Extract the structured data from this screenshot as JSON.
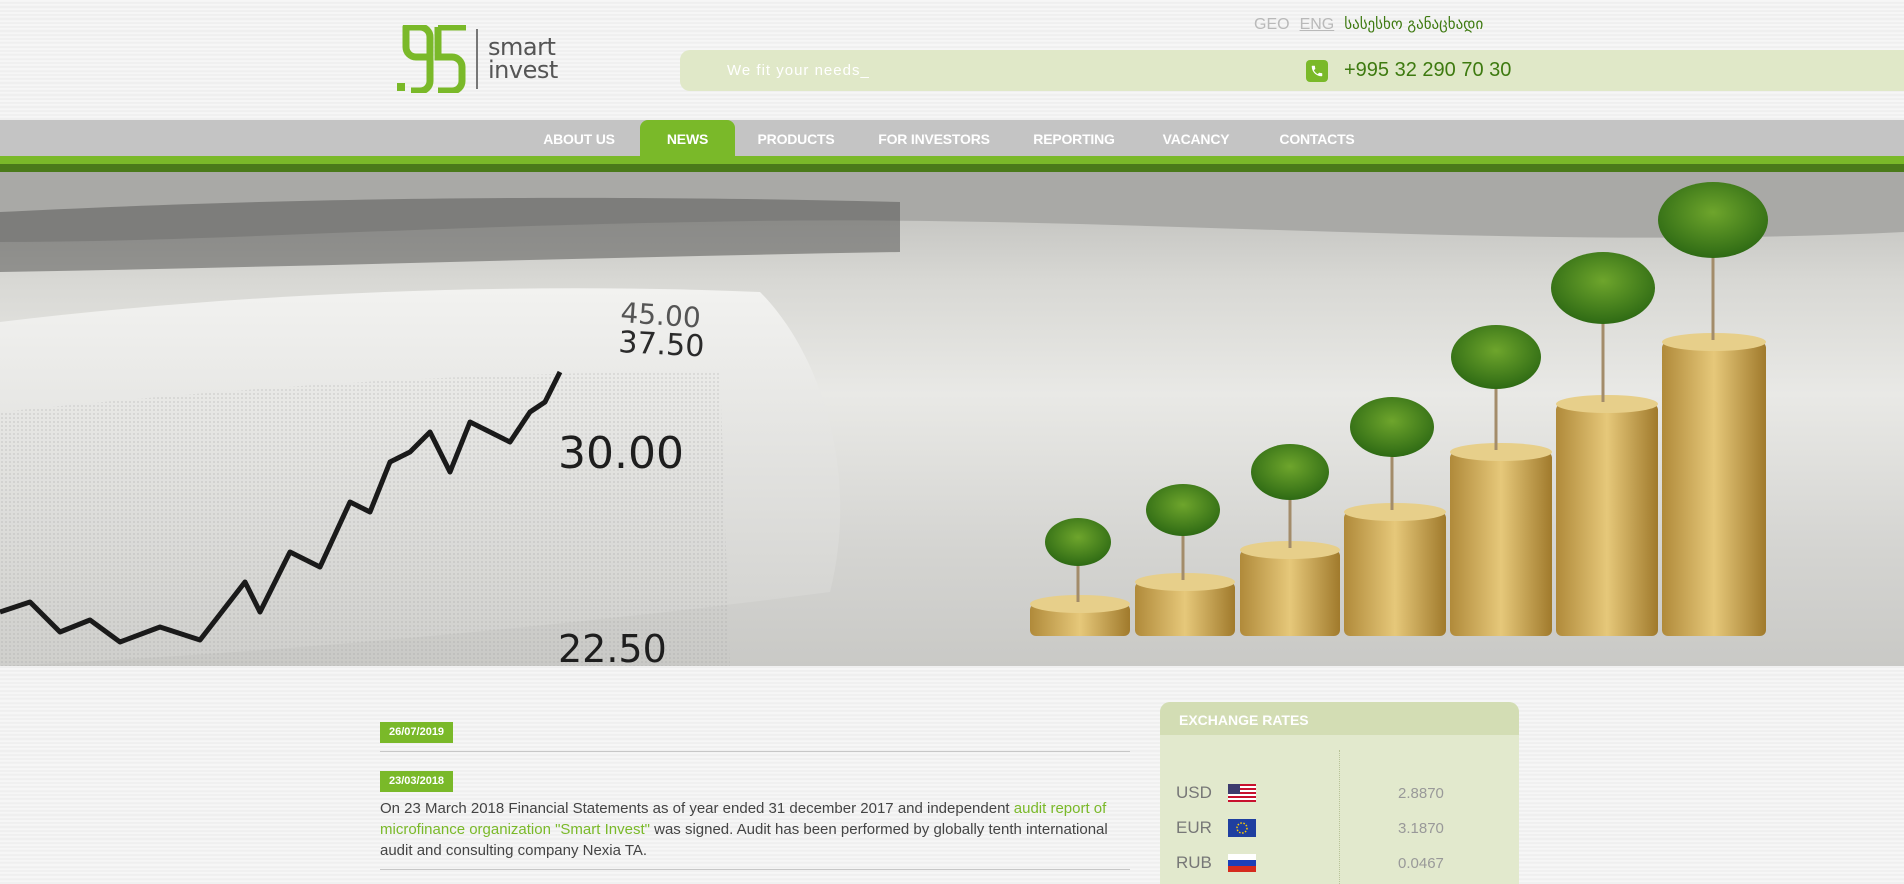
{
  "brand": {
    "logo_line1": "smart",
    "logo_line2": "invest"
  },
  "lang": {
    "geo": "GEO",
    "eng": "ENG",
    "apply": "სასესხო განაცხადი"
  },
  "header": {
    "tagline": "We fit your needs_",
    "phone": "+995 32 290 70 30"
  },
  "nav": {
    "items": [
      {
        "label": "ABOUT US",
        "active": false
      },
      {
        "label": "NEWS",
        "active": true
      },
      {
        "label": "PRODUCTS",
        "active": false
      },
      {
        "label": "FOR INVESTORS",
        "active": false
      },
      {
        "label": "REPORTING",
        "active": false
      },
      {
        "label": "VACANCY",
        "active": false
      },
      {
        "label": "CONTACTS",
        "active": false
      }
    ]
  },
  "hero": {
    "ticks": [
      "45.00",
      "37.50",
      "30.00",
      "22.50"
    ]
  },
  "news": {
    "items": [
      {
        "date": "26/07/2019"
      },
      {
        "date": "23/03/2018",
        "text_before": "On 23 March 2018 Financial Statements as of year ended 31 december 2017 and independent ",
        "link": "audit report of microfinance organization \"Smart Invest\"",
        "text_after": " was signed. Audit has been performed by globally tenth international audit and consulting company Nexia TA."
      }
    ]
  },
  "rates": {
    "title": "EXCHANGE RATES",
    "rows": [
      {
        "code": "USD",
        "value": "2.8870",
        "flag": "us-flag"
      },
      {
        "code": "EUR",
        "value": "3.1870",
        "flag": "eu-flag"
      },
      {
        "code": "RUB",
        "value": "0.0467",
        "flag": "ru-flag"
      }
    ]
  },
  "colors": {
    "accent": "#7ab929",
    "dark_green": "#3e7a10",
    "nav_gray": "#c4c4c4",
    "panel": "#e2e9cd"
  }
}
